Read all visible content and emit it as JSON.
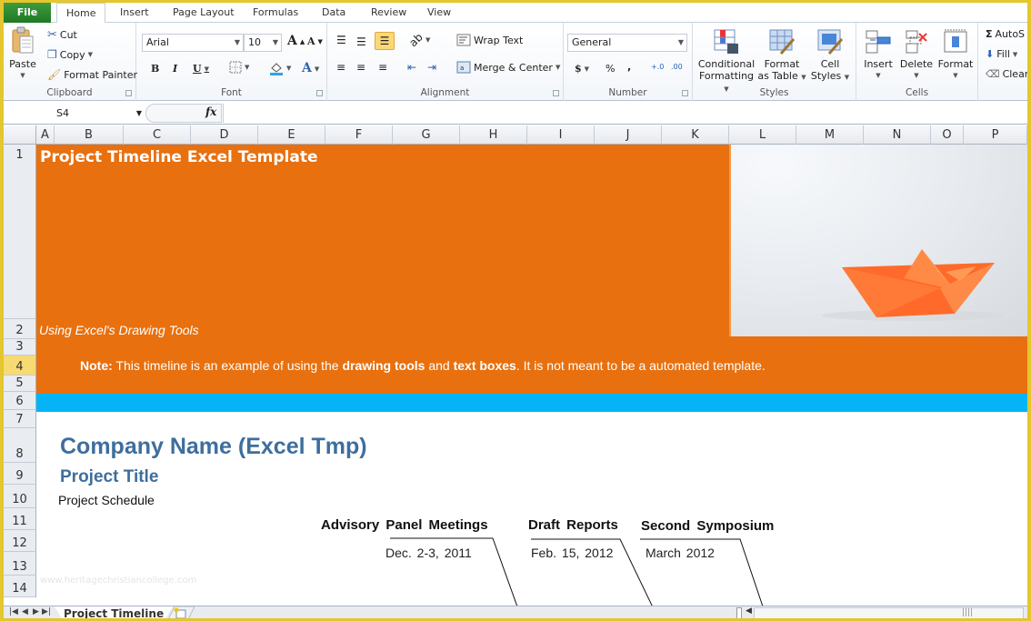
{
  "tabs": {
    "file": "File",
    "items": [
      "Home",
      "Insert",
      "Page Layout",
      "Formulas",
      "Data",
      "Review",
      "View"
    ],
    "active": "Home"
  },
  "ribbon": {
    "clipboard": {
      "label": "Clipboard",
      "paste": "Paste",
      "cut": "Cut",
      "copy": "Copy",
      "format_painter": "Format Painter"
    },
    "font": {
      "label": "Font",
      "font_name": "Arial",
      "font_size": "10",
      "bold": "B",
      "italic": "I",
      "underline": "U",
      "grow": "A",
      "shrink": "A",
      "font_color": "A"
    },
    "alignment": {
      "label": "Alignment",
      "wrap_text": "Wrap Text",
      "merge_center": "Merge & Center"
    },
    "number": {
      "label": "Number",
      "format": "General",
      "currency": "$",
      "percent": "%",
      "comma": ",",
      "inc_decimal": "+.0",
      "dec_decimal": ".00"
    },
    "styles": {
      "label": "Styles",
      "conditional_formatting": [
        "Conditional",
        "Formatting"
      ],
      "format_as_table": [
        "Format",
        "as Table"
      ],
      "cell_styles": [
        "Cell",
        "Styles"
      ]
    },
    "cells": {
      "label": "Cells",
      "insert": "Insert",
      "delete": "Delete",
      "format": "Format"
    },
    "editing": {
      "autosum": "AutoS",
      "fill": "Fill",
      "clear": "Clear"
    }
  },
  "formula_bar": {
    "name_box": "S4",
    "fx": "fx",
    "value": ""
  },
  "columns": [
    "A",
    "B",
    "C",
    "D",
    "E",
    "F",
    "G",
    "H",
    "I",
    "J",
    "K",
    "L",
    "M",
    "N",
    "O",
    "P"
  ],
  "rows": [
    "1",
    "2",
    "3",
    "4",
    "5",
    "6",
    "7",
    "8",
    "9",
    "10",
    "11",
    "12",
    "13",
    "14"
  ],
  "selected_row": "4",
  "sheet": {
    "title": "Project Timeline Excel Template",
    "subtitle": "Using Excel's Drawing Tools",
    "note": {
      "lead": "Note:",
      "part1": " This timeline is an example of using the ",
      "bold1": "drawing tools",
      "part2": " and ",
      "bold2": "text boxes",
      "part3": ". It is not meant to be a automated template."
    },
    "company": "Company Name (Excel Tmp)",
    "project_title": "Project Title",
    "project_schedule": "Project Schedule",
    "milestones": [
      {
        "label": "Advisory  Panel Meetings",
        "date": "Dec. 2-3, 2011"
      },
      {
        "label": "Draft Reports",
        "date": "Feb. 15, 2012"
      },
      {
        "label": "Second  Symposium",
        "date": "March  2012"
      }
    ],
    "watermark": "www.heritagechristiancollege.com",
    "colors": {
      "banner": "#e8700e",
      "band": "#04b4f4",
      "heading": "#3e6e9e"
    }
  },
  "sheet_tabs": {
    "active": "Project Timeline"
  }
}
